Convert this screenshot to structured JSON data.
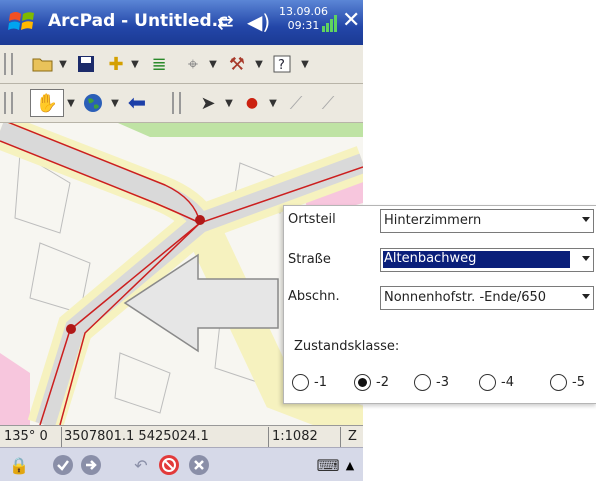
{
  "titlebar": {
    "app_title": "ArcPad - Untitled.c",
    "clock_date": "13.09.06",
    "clock_time": "09:31",
    "icons": [
      "windows-logo-icon",
      "connection-icon",
      "volume-icon",
      "signal-icon",
      "close-icon"
    ]
  },
  "toolbar1": {
    "icons": [
      "open-folder-icon",
      "save-icon",
      "add-layer-icon",
      "layers-icon",
      "gps-icon",
      "tools-icon",
      "help-icon"
    ]
  },
  "toolbar2": {
    "icons": [
      "pan-hand-icon",
      "globe-icon",
      "back-arrow-icon",
      "select-pointer-icon",
      "point-icon",
      "polyline-icon",
      "polygon-icon"
    ]
  },
  "statusbar": {
    "heading": "135° 0",
    "coordinates": "3507801.1 5425024.1",
    "scale": "1:1082",
    "zoom_label": "Z"
  },
  "bottombar": {
    "icons": [
      "lock-icon",
      "ok-icon",
      "forward-icon",
      "undo-icon",
      "stop-icon",
      "cancel-icon",
      "keyboard-icon",
      "up-arrow-icon"
    ]
  },
  "form": {
    "fields": [
      {
        "label": "Ortsteil",
        "value": "Hinterzimmern"
      },
      {
        "label": "Straße",
        "value": "Altenbachweg"
      },
      {
        "label": "Abschn.",
        "value": "Nonnenhofstr. -Ende/650"
      }
    ],
    "section_title": "Zustandsklasse:",
    "radios": [
      {
        "label": "-1",
        "selected": false
      },
      {
        "label": "-2",
        "selected": true
      },
      {
        "label": "-3",
        "selected": false
      },
      {
        "label": "-4",
        "selected": false
      },
      {
        "label": "-5",
        "selected": false
      }
    ]
  },
  "colors": {
    "title_blue": "#2346a8",
    "road_red": "#cc1f1f",
    "road_yellow": "#f6f2bf",
    "grass_green": "#bfe3a4",
    "pink_area": "#f7c6dd",
    "selection_blue": "#0a1f7a"
  }
}
